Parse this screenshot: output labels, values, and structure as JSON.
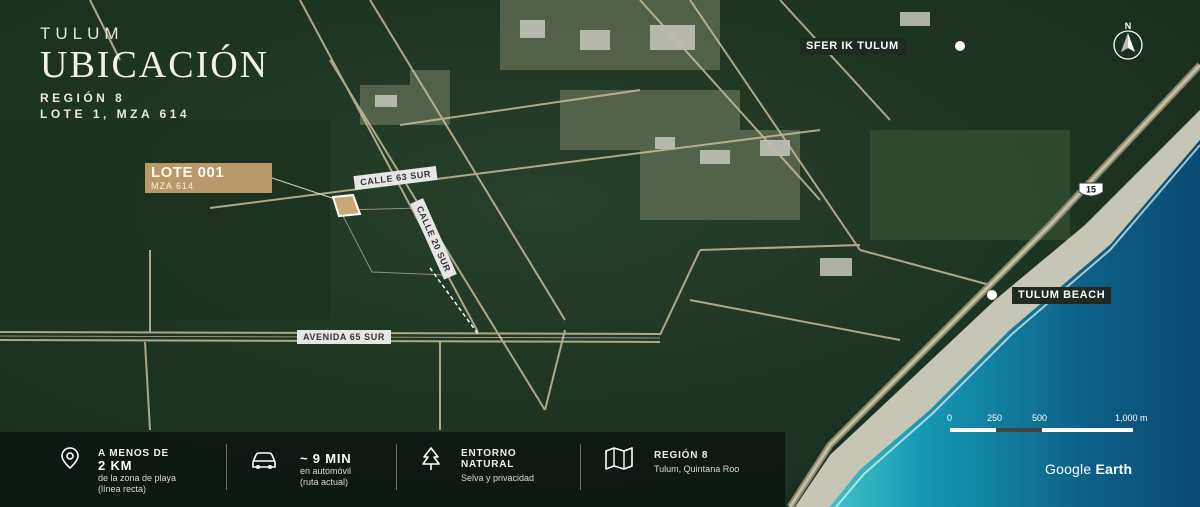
{
  "title": {
    "city": "TULUM",
    "main": "UBICACIÓN"
  },
  "subtitle": {
    "line1": "REGIÓN 8",
    "line2": "LOTE 1, MZA 614"
  },
  "lot_card": {
    "title": "LOTE 001",
    "subtitle": "MZA 614"
  },
  "streets": {
    "calle63": "CALLE 63 SUR",
    "calle20": "CALLE 20 SUR",
    "avenida65": "AVENIDA 65 SUR"
  },
  "pois": {
    "sfer": "SFER IK TULUM",
    "beach": "TULUM BEACH"
  },
  "compass_label": "N",
  "highway_label": "15",
  "scale": {
    "labels": [
      "0",
      "250",
      "500",
      "1,000 m"
    ]
  },
  "features": [
    {
      "icon": "map-pin-icon",
      "heading": "A MENOS DE",
      "value": "2 KM",
      "desc_line1": "de la zona de playa",
      "desc_line2": "(línea recta)"
    },
    {
      "icon": "car-icon",
      "value": "~ 9 MIN",
      "desc_line1": "en automóvil",
      "desc_line2": "(ruta actual)"
    },
    {
      "icon": "tree-icon",
      "heading_line1": "ENTORNO",
      "heading_line2": "NATURAL",
      "desc_line1": "Selva y privacidad"
    },
    {
      "icon": "map-icon",
      "heading": "REGIÓN 8",
      "desc_line1": "Tulum, Quintana Roo"
    }
  ],
  "attribution": {
    "brand": "Google",
    "product": "Earth"
  },
  "colors": {
    "jungle": "#1f3323",
    "ocean": "#1c8fa6",
    "accent_gold": "#b9986a",
    "road": "#cbbf9d"
  }
}
